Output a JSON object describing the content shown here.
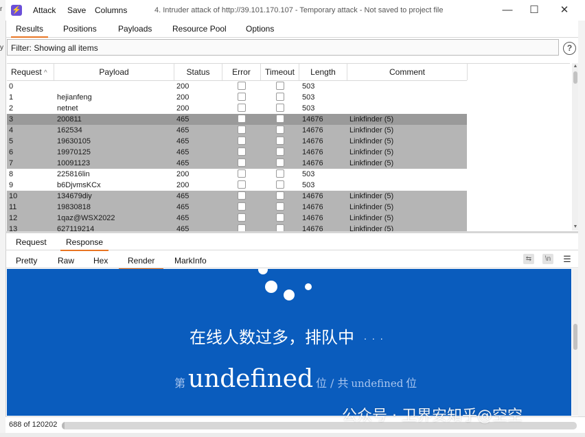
{
  "window": {
    "title": "4. Intruder attack of http://39.101.170.107 - Temporary attack - Not saved to project file",
    "menu": [
      "Attack",
      "Save",
      "Columns"
    ],
    "app_icon_glyph": "⚡",
    "controls": {
      "minimize": "—",
      "maximize": "☐",
      "close": "✕"
    }
  },
  "tabs": [
    "Results",
    "Positions",
    "Payloads",
    "Resource Pool",
    "Options"
  ],
  "active_tab": "Results",
  "filter": {
    "text": "Filter: Showing all items",
    "help_glyph": "?"
  },
  "table": {
    "columns": [
      "Request",
      "Payload",
      "Status",
      "Error",
      "Timeout",
      "Length",
      "Comment"
    ],
    "sort_indicator": "^",
    "rows": [
      {
        "request": "0",
        "payload": "",
        "status": "200",
        "length": "503",
        "comment": "",
        "highlight": "none"
      },
      {
        "request": "1",
        "payload": "hejianfeng",
        "status": "200",
        "length": "503",
        "comment": "",
        "highlight": "none"
      },
      {
        "request": "2",
        "payload": "netnet",
        "status": "200",
        "length": "503",
        "comment": "",
        "highlight": "none"
      },
      {
        "request": "3",
        "payload": "200811",
        "status": "465",
        "length": "14676",
        "comment": "Linkfinder (5)",
        "highlight": "selected"
      },
      {
        "request": "4",
        "payload": "162534",
        "status": "465",
        "length": "14676",
        "comment": "Linkfinder (5)",
        "highlight": "grey"
      },
      {
        "request": "5",
        "payload": "19630105",
        "status": "465",
        "length": "14676",
        "comment": "Linkfinder (5)",
        "highlight": "grey"
      },
      {
        "request": "6",
        "payload": "19970125",
        "status": "465",
        "length": "14676",
        "comment": "Linkfinder (5)",
        "highlight": "grey"
      },
      {
        "request": "7",
        "payload": "10091123",
        "status": "465",
        "length": "14676",
        "comment": "Linkfinder (5)",
        "highlight": "grey"
      },
      {
        "request": "8",
        "payload": "225816lin",
        "status": "200",
        "length": "503",
        "comment": "",
        "highlight": "none"
      },
      {
        "request": "9",
        "payload": "b6DjvmsKCx",
        "status": "200",
        "length": "503",
        "comment": "",
        "highlight": "none"
      },
      {
        "request": "10",
        "payload": "134679diy",
        "status": "465",
        "length": "14676",
        "comment": "Linkfinder (5)",
        "highlight": "grey"
      },
      {
        "request": "11",
        "payload": "19830818",
        "status": "465",
        "length": "14676",
        "comment": "Linkfinder (5)",
        "highlight": "grey"
      },
      {
        "request": "12",
        "payload": "1qaz@WSX2022",
        "status": "465",
        "length": "14676",
        "comment": "Linkfinder (5)",
        "highlight": "grey"
      },
      {
        "request": "13",
        "payload": "627119214",
        "status": "465",
        "length": "14676",
        "comment": "Linkfinder (5)",
        "highlight": "grey"
      }
    ]
  },
  "message_tabs": [
    "Request",
    "Response"
  ],
  "active_message_tab": "Response",
  "view_tabs": [
    "Pretty",
    "Raw",
    "Hex",
    "Render",
    "MarkInfo"
  ],
  "active_view_tab": "Render",
  "view_icons": {
    "wrap": "⇆",
    "newline": "\\n",
    "menu": "☰"
  },
  "render": {
    "queue_text": "在线人数过多，排队中",
    "queue_dots": "...",
    "pos_prefix": "第",
    "pos_value": "undefined",
    "pos_mid": "位 / 共",
    "total_value": "undefined",
    "pos_suffix": "位"
  },
  "status_bar": {
    "count": "688 of 120202",
    "progress_fraction": 0.0057
  },
  "watermark": "公众号 · 卫界安知乎@空空",
  "colors": {
    "accent_tab": "#e87422",
    "render_bg": "#0a5cbd",
    "row_grey": "#b5b5b5",
    "row_selected": "#9a9a9a",
    "app_icon": "#6b4fd8"
  }
}
